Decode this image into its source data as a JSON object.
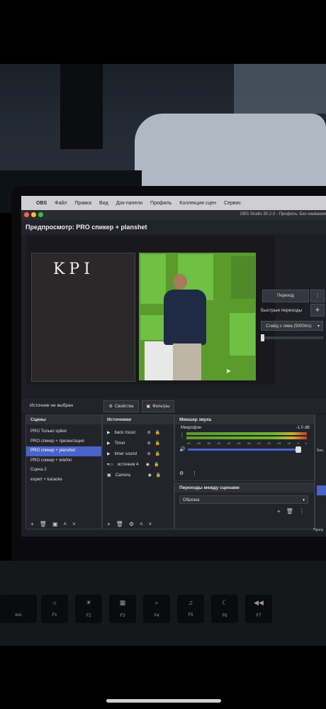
{
  "menubar": {
    "apple_icon": "apple-icon",
    "app": "OBS",
    "items": [
      "Файл",
      "Правка",
      "Вид",
      "Док-панели",
      "Профиль",
      "Коллекция сцен",
      "Сервис"
    ]
  },
  "window": {
    "title": "OBS Studio 30.2.0 - Профиль: Без названия"
  },
  "preview": {
    "label": "Предпросмотр: PRO спикер + planshet",
    "slide_text": "KPI"
  },
  "transitions_panel": {
    "transition_button": "Переход",
    "quick_label": "Быстрые переходы",
    "slide_option": "Слайд с лева (5000ms)"
  },
  "source_toolbar": {
    "status": "Источник не выбран",
    "properties": "Свойства",
    "filters": "Фильтры"
  },
  "scenes": {
    "title": "Сцены",
    "items": [
      "PRO Только spiker",
      "PRO спикер + презентация",
      "PRO спикер + planshet",
      "PRO спикер + telefon",
      "Сцена 2",
      "expert + karaoke"
    ],
    "selected_index": 2
  },
  "sources": {
    "title": "Источники",
    "items": [
      {
        "name": "back music",
        "icon": "play-icon"
      },
      {
        "name": "Timer",
        "icon": "play-icon"
      },
      {
        "name": "timer sound",
        "icon": "play-icon"
      },
      {
        "name": "источник 4",
        "icon": "folder-icon"
      },
      {
        "name": "Camera",
        "icon": "camera-icon"
      }
    ]
  },
  "mixer": {
    "title": "Микшер звука",
    "channel": "Микрофон",
    "level": "-1.0 dB",
    "scale": [
      "-60",
      "-55",
      "-50",
      "-45",
      "-40",
      "-35",
      "-30",
      "-25",
      "-20",
      "-15",
      "-10",
      "-5",
      "0"
    ]
  },
  "scene_transitions": {
    "title": "Переходы между сценами",
    "selected": "Обрезка"
  },
  "side_labels": {
    "sou": "Sou",
    "propu": "Пропу"
  },
  "keyboard": {
    "esc": "esc",
    "fkeys": [
      "F1",
      "F2",
      "F3",
      "F4",
      "F5",
      "F6",
      "F7"
    ]
  },
  "colors": {
    "accent": "#4a63c9",
    "green_screen": "#5a9b2c"
  }
}
